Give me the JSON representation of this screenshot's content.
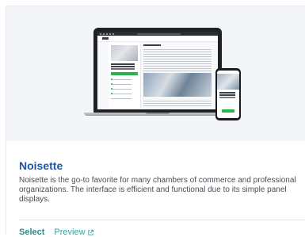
{
  "theme": {
    "name": "Noisette",
    "description": "Noisette is the go-to favorite for many chambers of commerce and professional organizations. The interface is efficient and functional due to its simple panel displays."
  },
  "actions": {
    "select_label": "Select",
    "preview_label": "Preview",
    "preview_icon": "external-link-icon"
  },
  "colors": {
    "title": "#1c57a5",
    "link": "#2b8a8a",
    "accent_green": "#2bb24c",
    "preview_background": "#f3f5f8"
  }
}
